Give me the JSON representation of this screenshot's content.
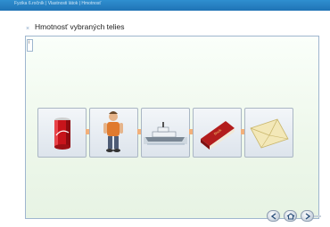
{
  "header": {
    "breadcrumb": "Fyzika 6.ročník | Vlastnosti látok | Hmotnosť"
  },
  "panel": {
    "title": "Hmotnosť vybraných telies",
    "close_glyph": "×",
    "tab_glyph": "i"
  },
  "sequence": {
    "items": [
      {
        "icon": "soda-can-icon"
      },
      {
        "icon": "person-icon"
      },
      {
        "icon": "ship-icon"
      },
      {
        "icon": "book-icon"
      },
      {
        "icon": "envelope-icon"
      }
    ]
  },
  "nav": {
    "buttons": [
      {
        "icon": "prev-icon"
      },
      {
        "icon": "home-icon"
      },
      {
        "icon": "next-icon"
      }
    ]
  },
  "colors": {
    "topbar": "#2f8fd0",
    "arrow": "#f0a060",
    "panel_border": "#9fb6cf"
  }
}
